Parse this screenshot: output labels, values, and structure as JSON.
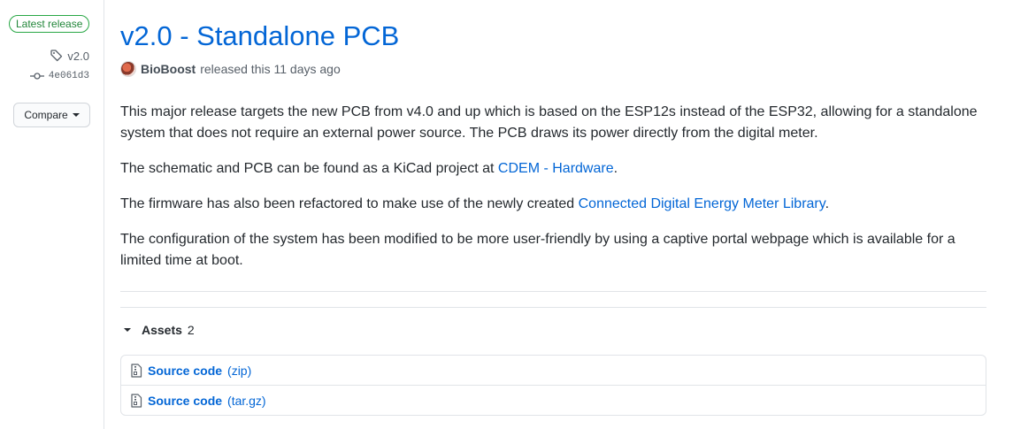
{
  "sidebar": {
    "badge": "Latest release",
    "tag": "v2.0",
    "commit": "4e061d3",
    "compare_label": "Compare"
  },
  "release": {
    "title": "v2.0 - Standalone PCB",
    "author": "BioBoost",
    "released_text": "released this 11 days ago",
    "paragraphs": {
      "p1": "This major release targets the new PCB from v4.0 and up which is based on the ESP12s instead of the ESP32, allowing for a standalone system that does not require an external power source. The PCB draws its power directly from the digital meter.",
      "p2_prefix": "The schematic and PCB can be found as a KiCad project at ",
      "p2_link": "CDEM - Hardware",
      "p2_suffix": ".",
      "p3_prefix": "The firmware has also been refactored to make use of the newly created ",
      "p3_link": "Connected Digital Energy Meter Library",
      "p3_suffix": ".",
      "p4": "The configuration of the system has been modified to be more user-friendly by using a captive portal webpage which is available for a limited time at boot."
    }
  },
  "assets": {
    "label": "Assets",
    "count": "2",
    "items": [
      {
        "name": "Source code",
        "format": "(zip)"
      },
      {
        "name": "Source code",
        "format": "(tar.gz)"
      }
    ]
  },
  "colors": {
    "link": "#0366d6",
    "badge_green": "#28a745"
  }
}
